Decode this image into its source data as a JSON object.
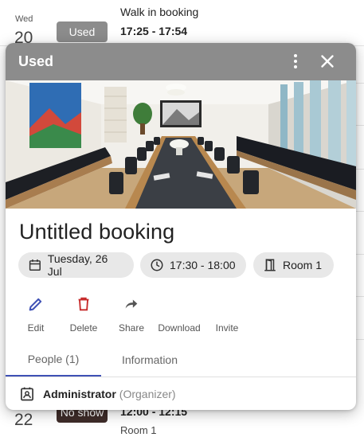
{
  "background_list": {
    "row1": {
      "day": "Wed",
      "date": "20",
      "status": "Used",
      "title": "Walk in booking",
      "time": "17:25 - 17:54"
    },
    "row2": {
      "date": "22",
      "status": "No show",
      "time": "12:00 - 12:15",
      "room": "Room 1"
    }
  },
  "modal": {
    "status": "Used",
    "header_color": "#8c8c8c",
    "more_icon": "more-vertical-icon",
    "close_icon": "close-icon",
    "title": "Untitled booking",
    "chips": {
      "date": "Tuesday, 26 Jul",
      "time": "17:30 - 18:00",
      "room": "Room 1"
    },
    "actions": {
      "edit": "Edit",
      "delete": "Delete",
      "share": "Share",
      "download": "Download",
      "invite": "Invite"
    },
    "tabs": {
      "people": "People (1)",
      "information": "Information"
    },
    "person": {
      "name": "Administrator",
      "role": "(Organizer)"
    },
    "colors": {
      "edit_icon": "#3f51b5",
      "delete_icon": "#c62828",
      "active_tab_underline": "#3f51b5"
    }
  }
}
